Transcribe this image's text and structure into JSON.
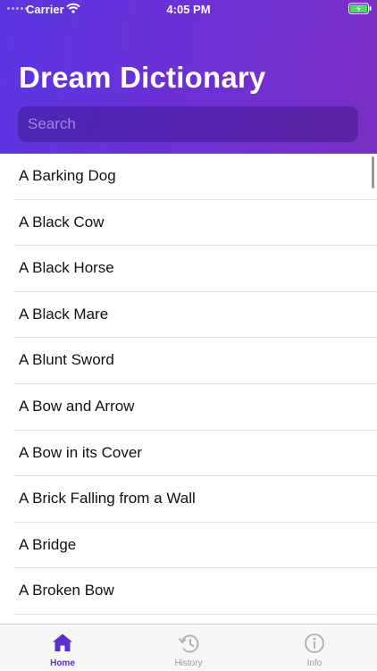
{
  "status_bar": {
    "carrier": "Carrier",
    "time": "4:05 PM"
  },
  "header": {
    "title": "Dream Dictionary"
  },
  "search": {
    "placeholder": "Search"
  },
  "entries": [
    "A Barking Dog",
    "A Black Cow",
    "A Black Horse",
    "A Black Mare",
    "A Blunt Sword",
    "A Bow and Arrow",
    "A Bow in its Cover",
    "A Brick Falling from a Wall",
    "A Bridge",
    "A Broken Bow"
  ],
  "tabs": [
    {
      "label": "Home",
      "icon": "home-icon",
      "active": true
    },
    {
      "label": "History",
      "icon": "history-icon",
      "active": false
    },
    {
      "label": "Info",
      "icon": "info-icon",
      "active": false
    }
  ],
  "colors": {
    "accent": "#5b2fc9",
    "header_start": "#5a36e0",
    "header_end": "#7a2fc4"
  }
}
